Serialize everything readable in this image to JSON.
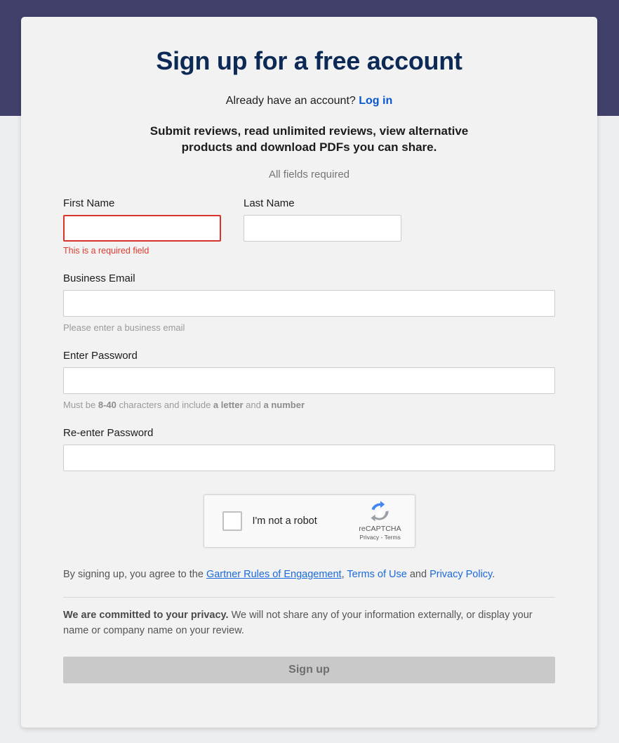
{
  "theme": {
    "backdrop_top": "#40406b",
    "backdrop_bottom": "#eceef0",
    "card_bg": "#f2f2f2",
    "title_color": "#0c2a55",
    "link_color": "#1a6ae0",
    "login_link_color": "#0b57d0",
    "error_color": "#d9342b",
    "hint_color": "#9a9a9a",
    "button_disabled_bg": "#c9c9c9",
    "button_disabled_text": "#6e6e6e"
  },
  "header": {
    "title": "Sign up for a free account",
    "already_have_account": "Already have an account?",
    "login_label": "Log in",
    "value_prop": "Submit reviews, read unlimited reviews, view alternative products and download PDFs you can share.",
    "all_fields_required": "All fields required"
  },
  "form": {
    "first_name": {
      "label": "First Name",
      "value": "",
      "placeholder": "",
      "error": "This is a required field",
      "has_error": true
    },
    "last_name": {
      "label": "Last Name",
      "value": "",
      "placeholder": "",
      "has_error": false
    },
    "business_email": {
      "label": "Business Email",
      "value": "",
      "placeholder": "",
      "hint": "Please enter a business email"
    },
    "password": {
      "label": "Enter Password",
      "value": "",
      "placeholder": "",
      "hint_prefix": "Must be ",
      "hint_bold_1": "8-40",
      "hint_middle": " characters and include ",
      "hint_bold_2": "a letter",
      "hint_join": " and ",
      "hint_bold_3": "a number"
    },
    "confirm_password": {
      "label": "Re-enter Password",
      "value": "",
      "placeholder": ""
    }
  },
  "recaptcha": {
    "checkbox_label": "I'm not a robot",
    "brand_name": "reCAPTCHA",
    "legal": "Privacy - Terms",
    "checked": false,
    "logo_blue": "#4285f4",
    "logo_gray": "#9aa0a6"
  },
  "terms": {
    "prefix": "By signing up, you agree to the ",
    "link_rules": "Gartner Rules of Engagement",
    "comma": ", ",
    "link_terms": "Terms of Use",
    "join": " and ",
    "link_privacy": "Privacy Policy",
    "suffix": "."
  },
  "privacy_notice": {
    "bold_lead": "We are committed to your privacy.",
    "body": " We will not share any of your information externally, or display your name or company name on your review."
  },
  "submit": {
    "label": "Sign up",
    "disabled": true
  }
}
